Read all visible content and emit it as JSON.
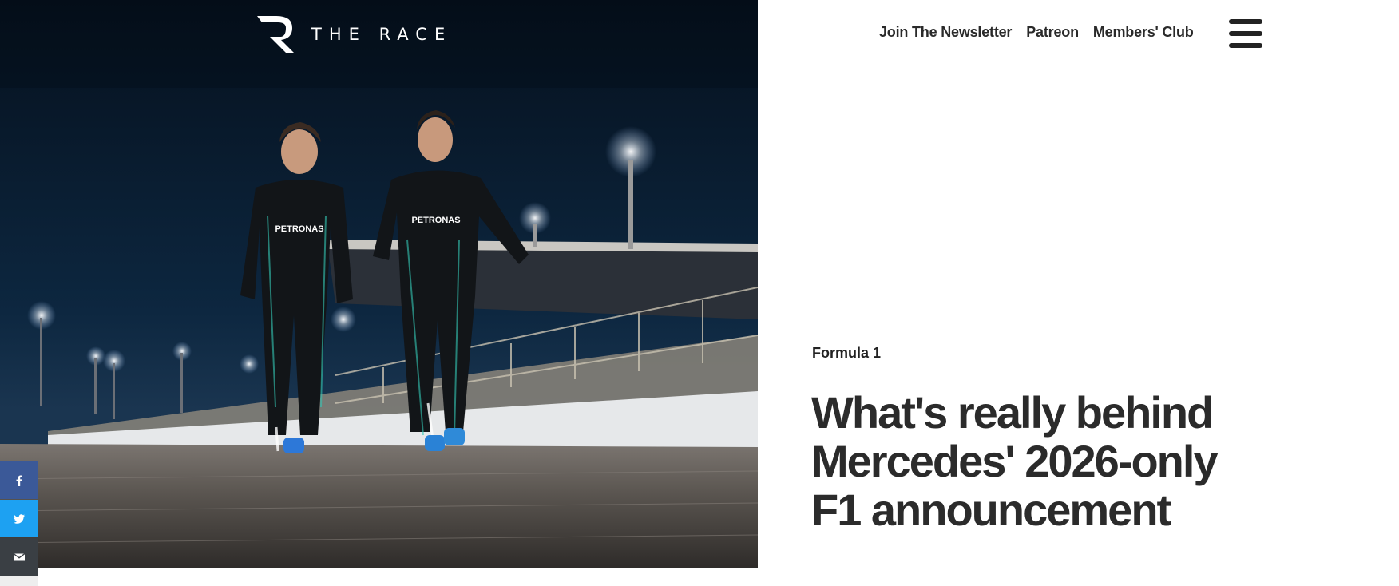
{
  "brand": {
    "logo_text": "THE RACE",
    "logo_icon": "r-logo-icon"
  },
  "nav": {
    "items": [
      {
        "label": "Join The Newsletter"
      },
      {
        "label": "Patreon"
      },
      {
        "label": "Members' Club"
      }
    ],
    "menu_icon": "hamburger-menu-icon"
  },
  "article": {
    "category": "Formula 1",
    "headline": "What's really behind Mercedes' 2026-only F1 announcement",
    "hero_alt": "Two Mercedes F1 drivers in black Petronas race suits walking along the pit lane at night",
    "suit_logo": "PETRONAS"
  },
  "share": {
    "buttons": [
      {
        "icon": "facebook-icon",
        "color": "#3b5998"
      },
      {
        "icon": "twitter-icon",
        "color": "#1da1f2"
      },
      {
        "icon": "email-icon",
        "color": "#3a3f44"
      }
    ]
  },
  "colors": {
    "text_dark": "#2b2b2b",
    "night_sky": "#0a1a2e"
  }
}
